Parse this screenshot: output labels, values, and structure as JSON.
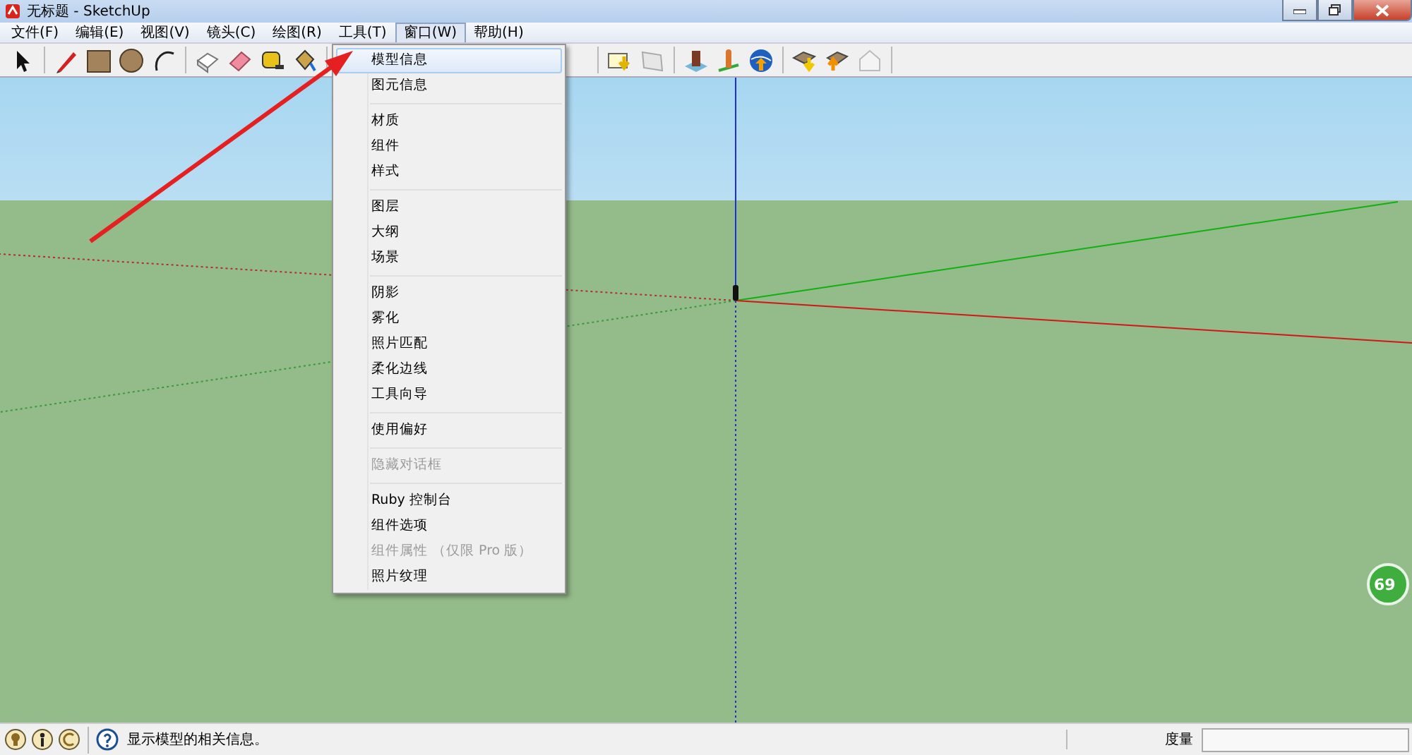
{
  "window": {
    "title": "无标题 - SketchUp"
  },
  "menubar": [
    {
      "label": "文件(F)",
      "selected": false
    },
    {
      "label": "编辑(E)",
      "selected": false
    },
    {
      "label": "视图(V)",
      "selected": false
    },
    {
      "label": "镜头(C)",
      "selected": false
    },
    {
      "label": "绘图(R)",
      "selected": false
    },
    {
      "label": "工具(T)",
      "selected": false
    },
    {
      "label": "窗口(W)",
      "selected": true
    },
    {
      "label": "帮助(H)",
      "selected": false
    }
  ],
  "toolbar_left": [
    {
      "kind": "select"
    },
    {
      "kind": "sep"
    },
    {
      "kind": "pencil"
    },
    {
      "kind": "rect"
    },
    {
      "kind": "circle"
    },
    {
      "kind": "arc"
    },
    {
      "kind": "sep"
    },
    {
      "kind": "box"
    },
    {
      "kind": "eraser"
    },
    {
      "kind": "tape"
    },
    {
      "kind": "bucket"
    },
    {
      "kind": "sep"
    }
  ],
  "toolbar_right": [
    {
      "kind": "sep"
    },
    {
      "kind": "import"
    },
    {
      "kind": "photo"
    },
    {
      "kind": "sep"
    },
    {
      "kind": "building"
    },
    {
      "kind": "pin"
    },
    {
      "kind": "globe"
    },
    {
      "kind": "sep"
    },
    {
      "kind": "download"
    },
    {
      "kind": "upload"
    },
    {
      "kind": "house"
    },
    {
      "kind": "sep"
    }
  ],
  "dropdown": [
    {
      "kind": "item",
      "label": "模型信息",
      "selected": true,
      "disabled": false
    },
    {
      "kind": "item",
      "label": "图元信息",
      "selected": false,
      "disabled": false
    },
    {
      "kind": "separator"
    },
    {
      "kind": "item",
      "label": "材质",
      "selected": false,
      "disabled": false
    },
    {
      "kind": "item",
      "label": "组件",
      "selected": false,
      "disabled": false
    },
    {
      "kind": "item",
      "label": "样式",
      "selected": false,
      "disabled": false
    },
    {
      "kind": "separator"
    },
    {
      "kind": "item",
      "label": "图层",
      "selected": false,
      "disabled": false
    },
    {
      "kind": "item",
      "label": "大纲",
      "selected": false,
      "disabled": false
    },
    {
      "kind": "item",
      "label": "场景",
      "selected": false,
      "disabled": false
    },
    {
      "kind": "separator"
    },
    {
      "kind": "item",
      "label": "阴影",
      "selected": false,
      "disabled": false
    },
    {
      "kind": "item",
      "label": "雾化",
      "selected": false,
      "disabled": false
    },
    {
      "kind": "item",
      "label": "照片匹配",
      "selected": false,
      "disabled": false
    },
    {
      "kind": "item",
      "label": "柔化边线",
      "selected": false,
      "disabled": false
    },
    {
      "kind": "item",
      "label": "工具向导",
      "selected": false,
      "disabled": false
    },
    {
      "kind": "separator"
    },
    {
      "kind": "item",
      "label": "使用偏好",
      "selected": false,
      "disabled": false
    },
    {
      "kind": "separator"
    },
    {
      "kind": "item",
      "label": "隐藏对话框",
      "selected": false,
      "disabled": true
    },
    {
      "kind": "separator"
    },
    {
      "kind": "item",
      "label": "Ruby 控制台",
      "selected": false,
      "disabled": false
    },
    {
      "kind": "item",
      "label": "组件选项",
      "selected": false,
      "disabled": false
    },
    {
      "kind": "item",
      "label": "组件属性 （仅限 Pro 版）",
      "selected": false,
      "disabled": true
    },
    {
      "kind": "item",
      "label": "照片纹理",
      "selected": false,
      "disabled": false
    }
  ],
  "badge": {
    "text": "69"
  },
  "status_bar": {
    "message": "显示模型的相关信息。",
    "measure_label": "度量"
  }
}
